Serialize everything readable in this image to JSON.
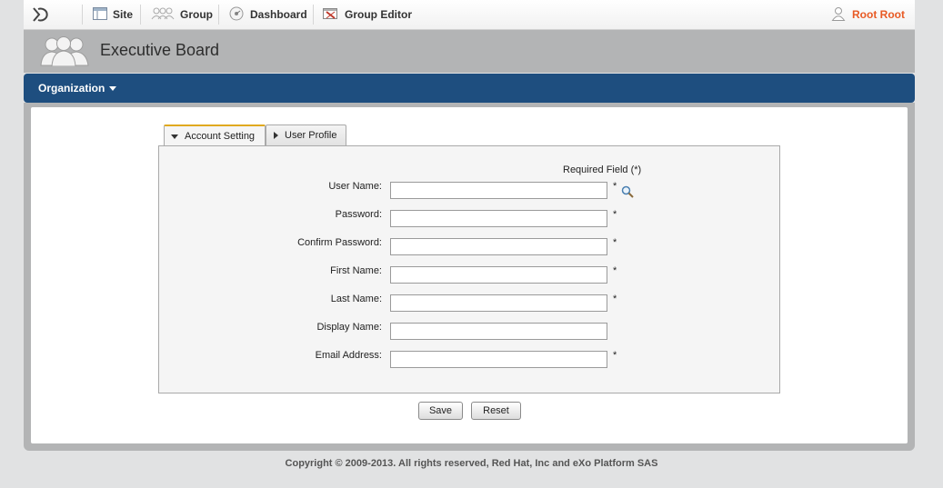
{
  "toolbar": {
    "logo_icon": "exo-logo-icon",
    "items": [
      {
        "label": "Site",
        "icon": "site-icon"
      },
      {
        "label": "Group",
        "icon": "group-icon"
      },
      {
        "label": "Dashboard",
        "icon": "dashboard-icon"
      },
      {
        "label": "Group Editor",
        "icon": "group-editor-icon"
      }
    ],
    "user": {
      "name": "Root Root",
      "icon": "user-icon"
    }
  },
  "header": {
    "title": "Executive Board",
    "icon": "group-people-icon"
  },
  "navbar": {
    "menu_label": "Organization"
  },
  "tabs": [
    {
      "label": "Account Setting",
      "active": true
    },
    {
      "label": "User Profile",
      "active": false
    }
  ],
  "form": {
    "required_note": "Required Field (*)",
    "fields": [
      {
        "label": "User Name:",
        "value": "",
        "required": true,
        "search": true
      },
      {
        "label": "Password:",
        "value": "",
        "required": true
      },
      {
        "label": "Confirm Password:",
        "value": "",
        "required": true
      },
      {
        "label": "First Name:",
        "value": "",
        "required": true
      },
      {
        "label": "Last Name:",
        "value": "",
        "required": true
      },
      {
        "label": "Display Name:",
        "value": "",
        "required": false
      },
      {
        "label": "Email Address:",
        "value": "",
        "required": true
      }
    ],
    "required_mark": "*"
  },
  "buttons": {
    "save": "Save",
    "reset": "Reset"
  },
  "footer": {
    "text": "Copyright © 2009-2013. All rights reserved, Red Hat, Inc and eXo Platform SAS"
  },
  "colors": {
    "nav_blue": "#1e4e7f",
    "user_orange": "#e85a24",
    "active_tab_accent": "#e0a91f"
  }
}
